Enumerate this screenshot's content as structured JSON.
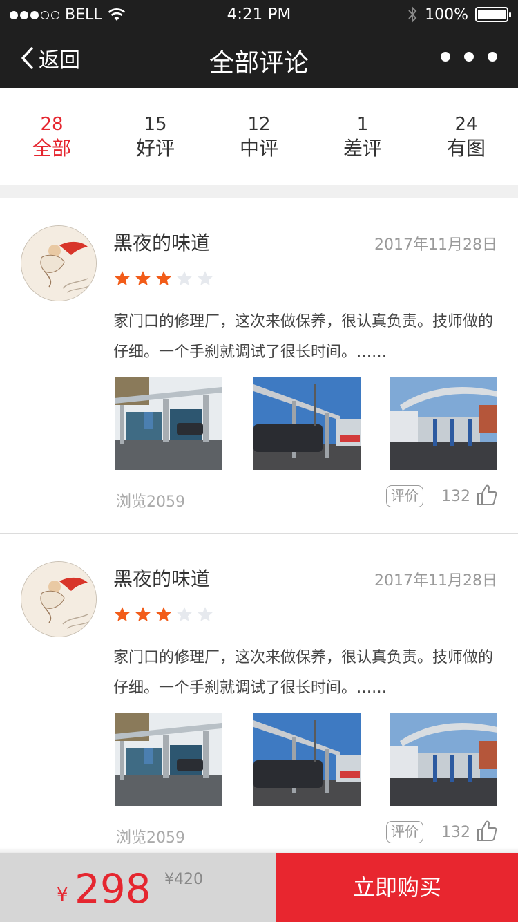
{
  "status_bar": {
    "carrier": "BELL",
    "time": "4:21 PM",
    "battery": "100%"
  },
  "nav": {
    "back_label": "返回",
    "title": "全部评论"
  },
  "tabs": [
    {
      "count": "28",
      "label": "全部",
      "active": true
    },
    {
      "count": "15",
      "label": "好评",
      "active": false
    },
    {
      "count": "12",
      "label": "中评",
      "active": false
    },
    {
      "count": "1",
      "label": "差评",
      "active": false
    },
    {
      "count": "24",
      "label": "有图",
      "active": false
    }
  ],
  "reviews": [
    {
      "username": "黑夜的味道",
      "date": "2017年11月28日",
      "rating": 3,
      "max_rating": 5,
      "text": "家门口的修理厂，这次来做保养，很认真负责。技师做的仔细。一个手刹就调试了很长时间。……",
      "views": "浏览2059",
      "comment_label": "评价",
      "likes": "132"
    },
    {
      "username": "黑夜的味道",
      "date": "2017年11月28日",
      "rating": 3,
      "max_rating": 5,
      "text": "家门口的修理厂，这次来做保养，很认真负责。技师做的仔细。一个手刹就调试了很长时间。……",
      "views": "浏览2059",
      "comment_label": "评价",
      "likes": "132"
    }
  ],
  "bottom_bar": {
    "currency": "¥",
    "price": "298",
    "original_price": "¥420",
    "buy_label": "立即购买"
  },
  "colors": {
    "accent": "#e5262f",
    "star_on": "#f25c19",
    "star_off": "#e6e9ee",
    "nav_bg": "#1f1f1f"
  }
}
